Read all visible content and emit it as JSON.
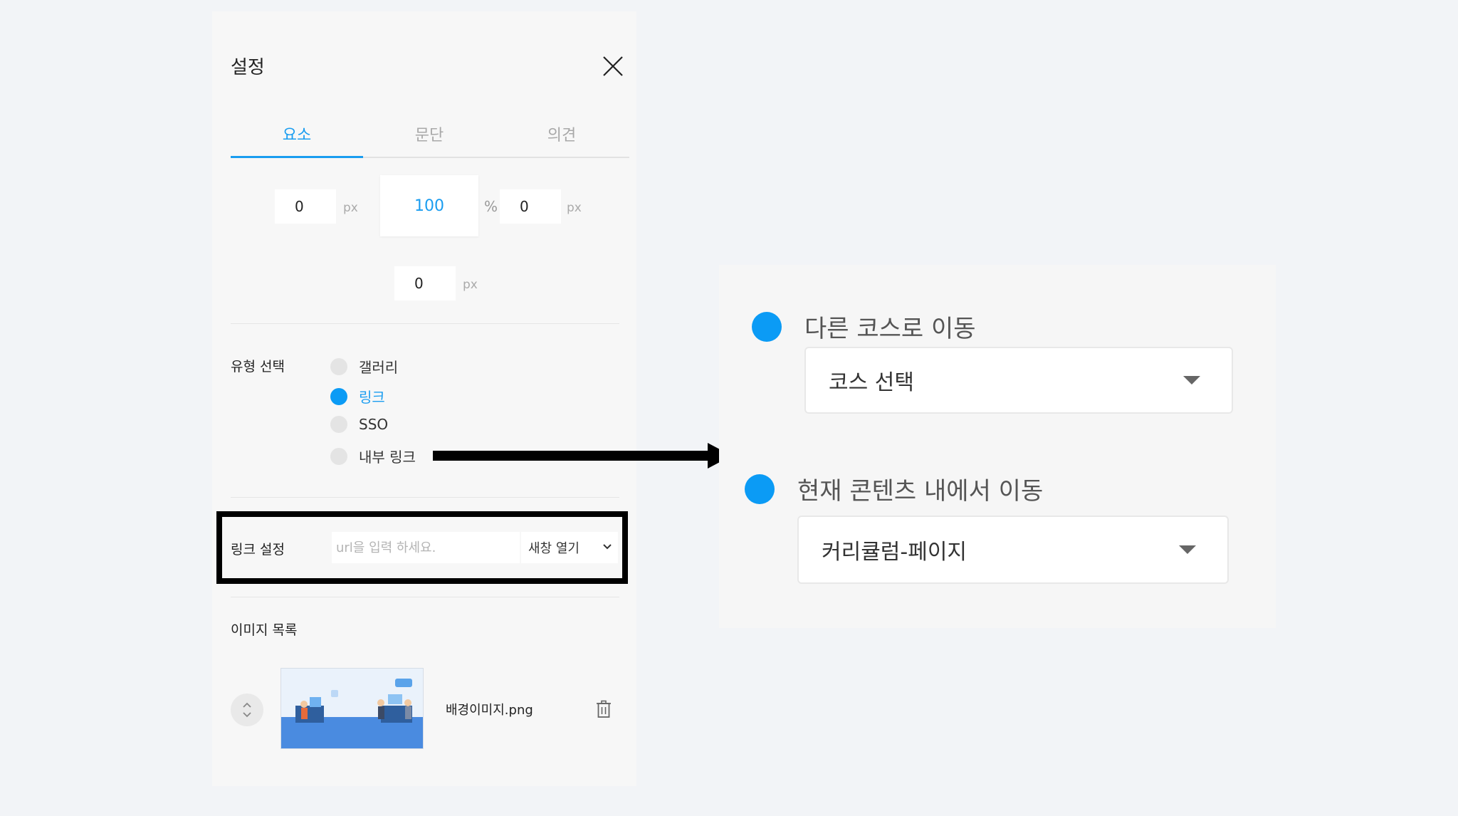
{
  "settings_panel": {
    "title": "설정",
    "tabs": [
      {
        "label": "요소",
        "active": true
      },
      {
        "label": "문단",
        "active": false
      },
      {
        "label": "의견",
        "active": false
      }
    ],
    "dimensions": {
      "left_value": "0",
      "left_unit": "px",
      "width_value": "100",
      "width_unit": "%",
      "right_value": "0",
      "right_unit": "px",
      "bottom_value": "0",
      "bottom_unit": "px"
    },
    "type_select": {
      "label": "유형 선택",
      "options": [
        {
          "label": "갤러리",
          "checked": false
        },
        {
          "label": "링크",
          "checked": true
        },
        {
          "label": "SSO",
          "checked": false
        },
        {
          "label": "내부 링크",
          "checked": false
        }
      ]
    },
    "link_settings": {
      "label": "링크 설정",
      "url_placeholder": "url을 입력 하세요.",
      "url_value": "",
      "target_selected": "새창 열기"
    },
    "image_list": {
      "label": "이미지 목록",
      "items": [
        {
          "file_name": "배경이미지.png"
        }
      ]
    }
  },
  "internal_link_card": {
    "options": [
      {
        "label": "다른 코스로 이동",
        "select_value": "코스 선택"
      },
      {
        "label": "현재 콘텐츠 내에서 이동",
        "select_value": "커리큘럼-페이지"
      }
    ]
  },
  "colors": {
    "accent": "#0b9bf5",
    "highlight_border": "#000000"
  }
}
